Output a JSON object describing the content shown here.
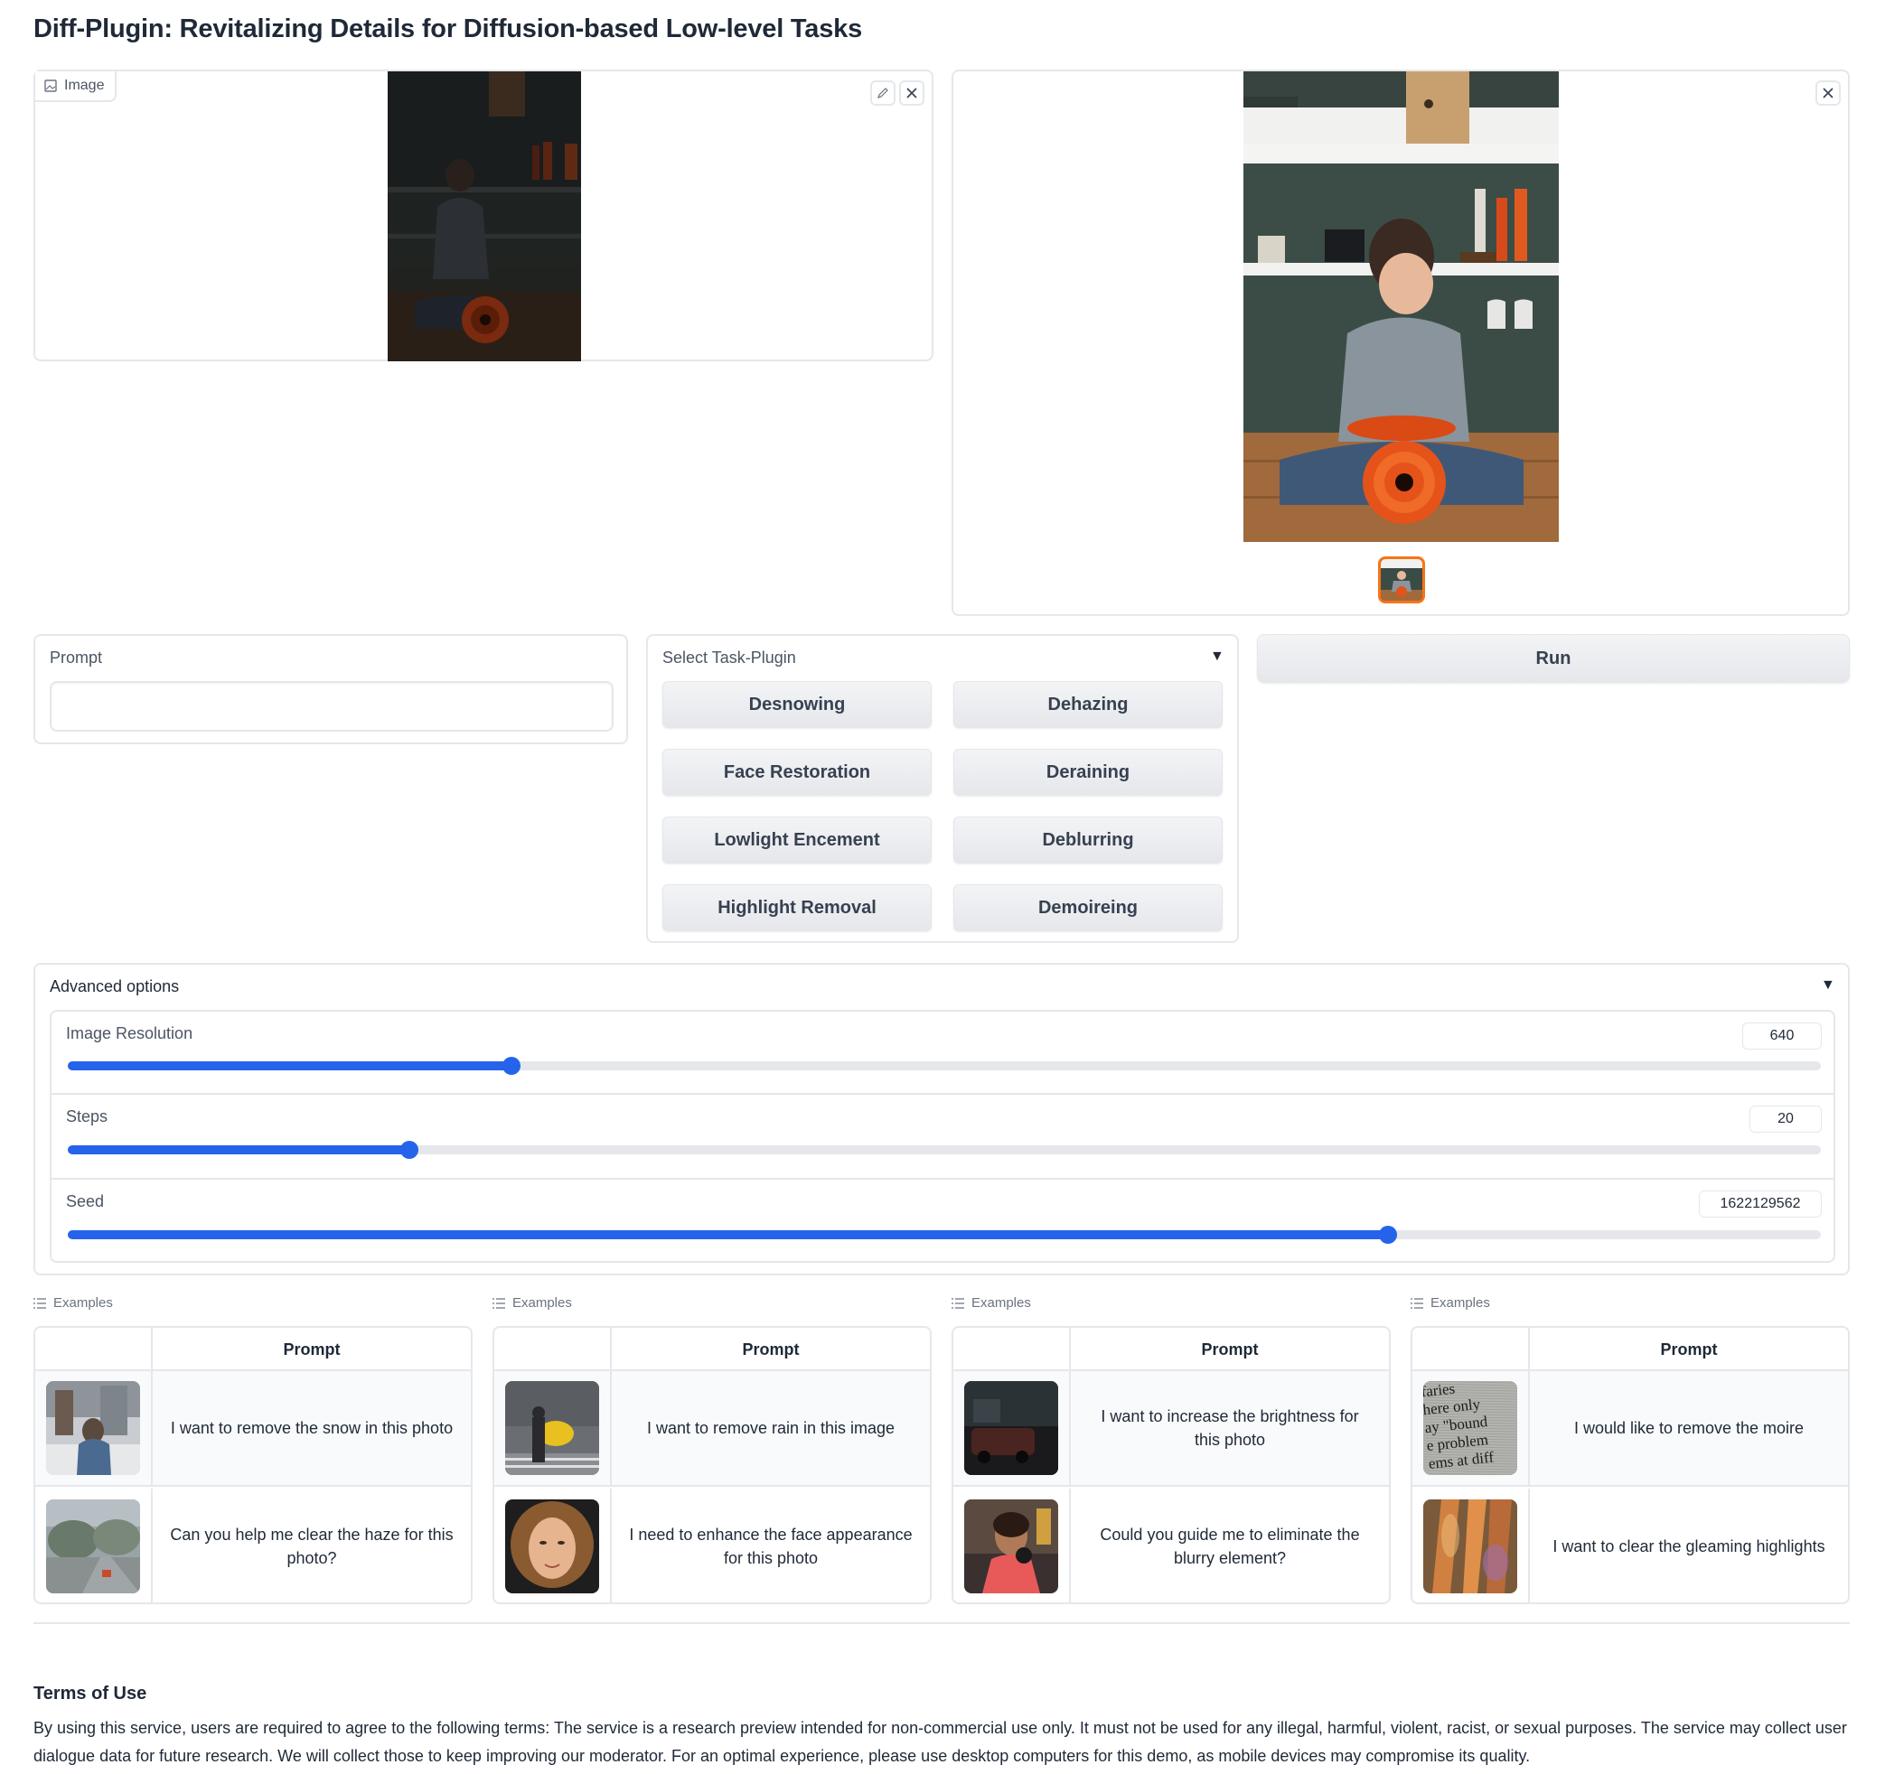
{
  "title": "Diff-Plugin: Revitalizing Details for Diffusion-based Low-level Tasks",
  "input_image": {
    "label": "Image",
    "icon": "image-icon",
    "edit_icon": "pencil-icon",
    "clear_icon": "close-icon"
  },
  "output_image": {
    "clear_icon": "close-icon"
  },
  "prompt": {
    "label": "Prompt",
    "value": "",
    "placeholder": ""
  },
  "task_plugin": {
    "label": "Select Task-Plugin",
    "buttons": [
      "Desnowing",
      "Dehazing",
      "Face Restoration",
      "Deraining",
      "Lowlight Encement",
      "Deblurring",
      "Highlight Removal",
      "Demoireing"
    ]
  },
  "run_label": "Run",
  "advanced": {
    "label": "Advanced options",
    "sliders": [
      {
        "label": "Image Resolution",
        "value": "640",
        "fraction": 0.253
      },
      {
        "label": "Steps",
        "value": "20",
        "fraction": 0.195
      },
      {
        "label": "Seed",
        "value": "1622129562",
        "fraction": 0.753
      }
    ]
  },
  "examples": [
    {
      "label": "Examples",
      "column": "Prompt",
      "rows": [
        "I want to remove the snow in this photo",
        "Can you help me clear the haze for this photo?"
      ]
    },
    {
      "label": "Examples",
      "column": "Prompt",
      "rows": [
        "I want to remove rain in this image",
        "I need to enhance the face appearance for this photo"
      ]
    },
    {
      "label": "Examples",
      "column": "Prompt",
      "rows": [
        "I want to increase the brightness for this photo",
        "Could you guide me to eliminate the blurry element?"
      ]
    },
    {
      "label": "Examples",
      "column": "Prompt",
      "rows": [
        "I would like to remove the moire",
        "I want to clear the gleaming highlights"
      ]
    }
  ],
  "moire_text": [
    "faries",
    "here only",
    "ay \"bound",
    "e problem",
    "ems at diff"
  ],
  "terms": {
    "heading": "Terms of Use",
    "body": "By using this service, users are required to agree to the following terms: The service is a research preview intended for non-commercial use only. It must not be used for any illegal, harmful, violent, racist, or sexual purposes. The service may collect user dialogue data for future research. We will collect those to keep improving our moderator. For an optimal experience, please use desktop computers for this demo, as mobile devices may compromise its quality."
  }
}
